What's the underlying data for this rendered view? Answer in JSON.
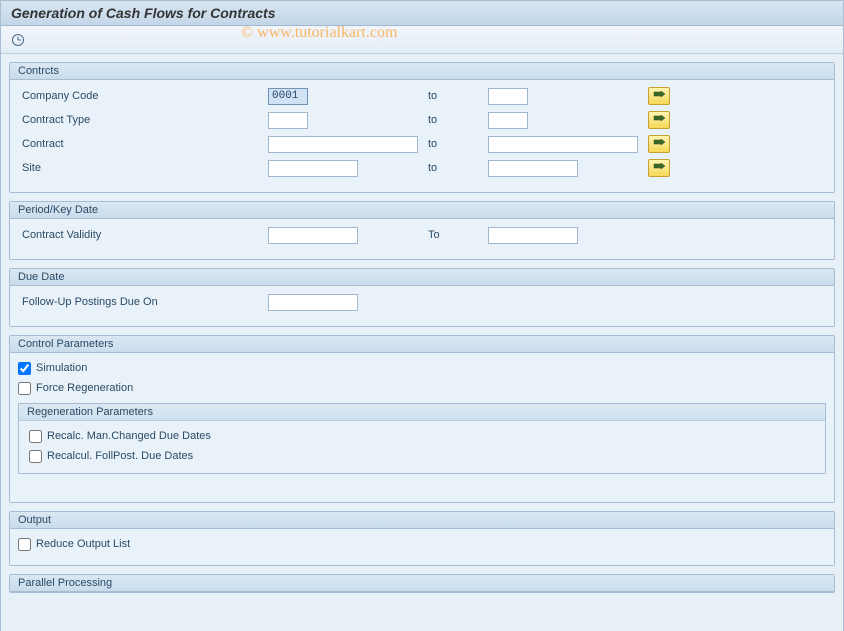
{
  "title": "Generation of Cash Flows for Contracts",
  "watermark": "© www.tutorialkart.com",
  "panels": {
    "contracts": {
      "header": "Contrcts",
      "rows": {
        "company_code": {
          "label": "Company Code",
          "from": "0001",
          "to_label": "to",
          "to": ""
        },
        "contract_type": {
          "label": "Contract Type",
          "from": "",
          "to_label": "to",
          "to": ""
        },
        "contract": {
          "label": "Contract",
          "from": "",
          "to_label": "to",
          "to": ""
        },
        "site": {
          "label": "Site",
          "from": "",
          "to_label": "to",
          "to": ""
        }
      }
    },
    "period": {
      "header": "Period/Key Date",
      "row": {
        "label": "Contract Validity",
        "from": "",
        "to_label": "To",
        "to": ""
      }
    },
    "due_date": {
      "header": "Due Date",
      "row": {
        "label": "Follow-Up Postings Due On",
        "value": ""
      }
    },
    "control": {
      "header": "Control Parameters",
      "simulation": "Simulation",
      "simulation_checked": true,
      "force_regen": "Force Regeneration",
      "force_regen_checked": false,
      "sub_header": "Regeneration Parameters",
      "recalc_man": "Recalc. Man.Changed Due Dates",
      "recalc_man_checked": false,
      "recalc_foll": "Recalcul. FollPost. Due Dates",
      "recalc_foll_checked": false
    },
    "output": {
      "header": "Output",
      "reduce": "Reduce Output List",
      "reduce_checked": false
    },
    "parallel": {
      "header": "Parallel Processing"
    }
  }
}
